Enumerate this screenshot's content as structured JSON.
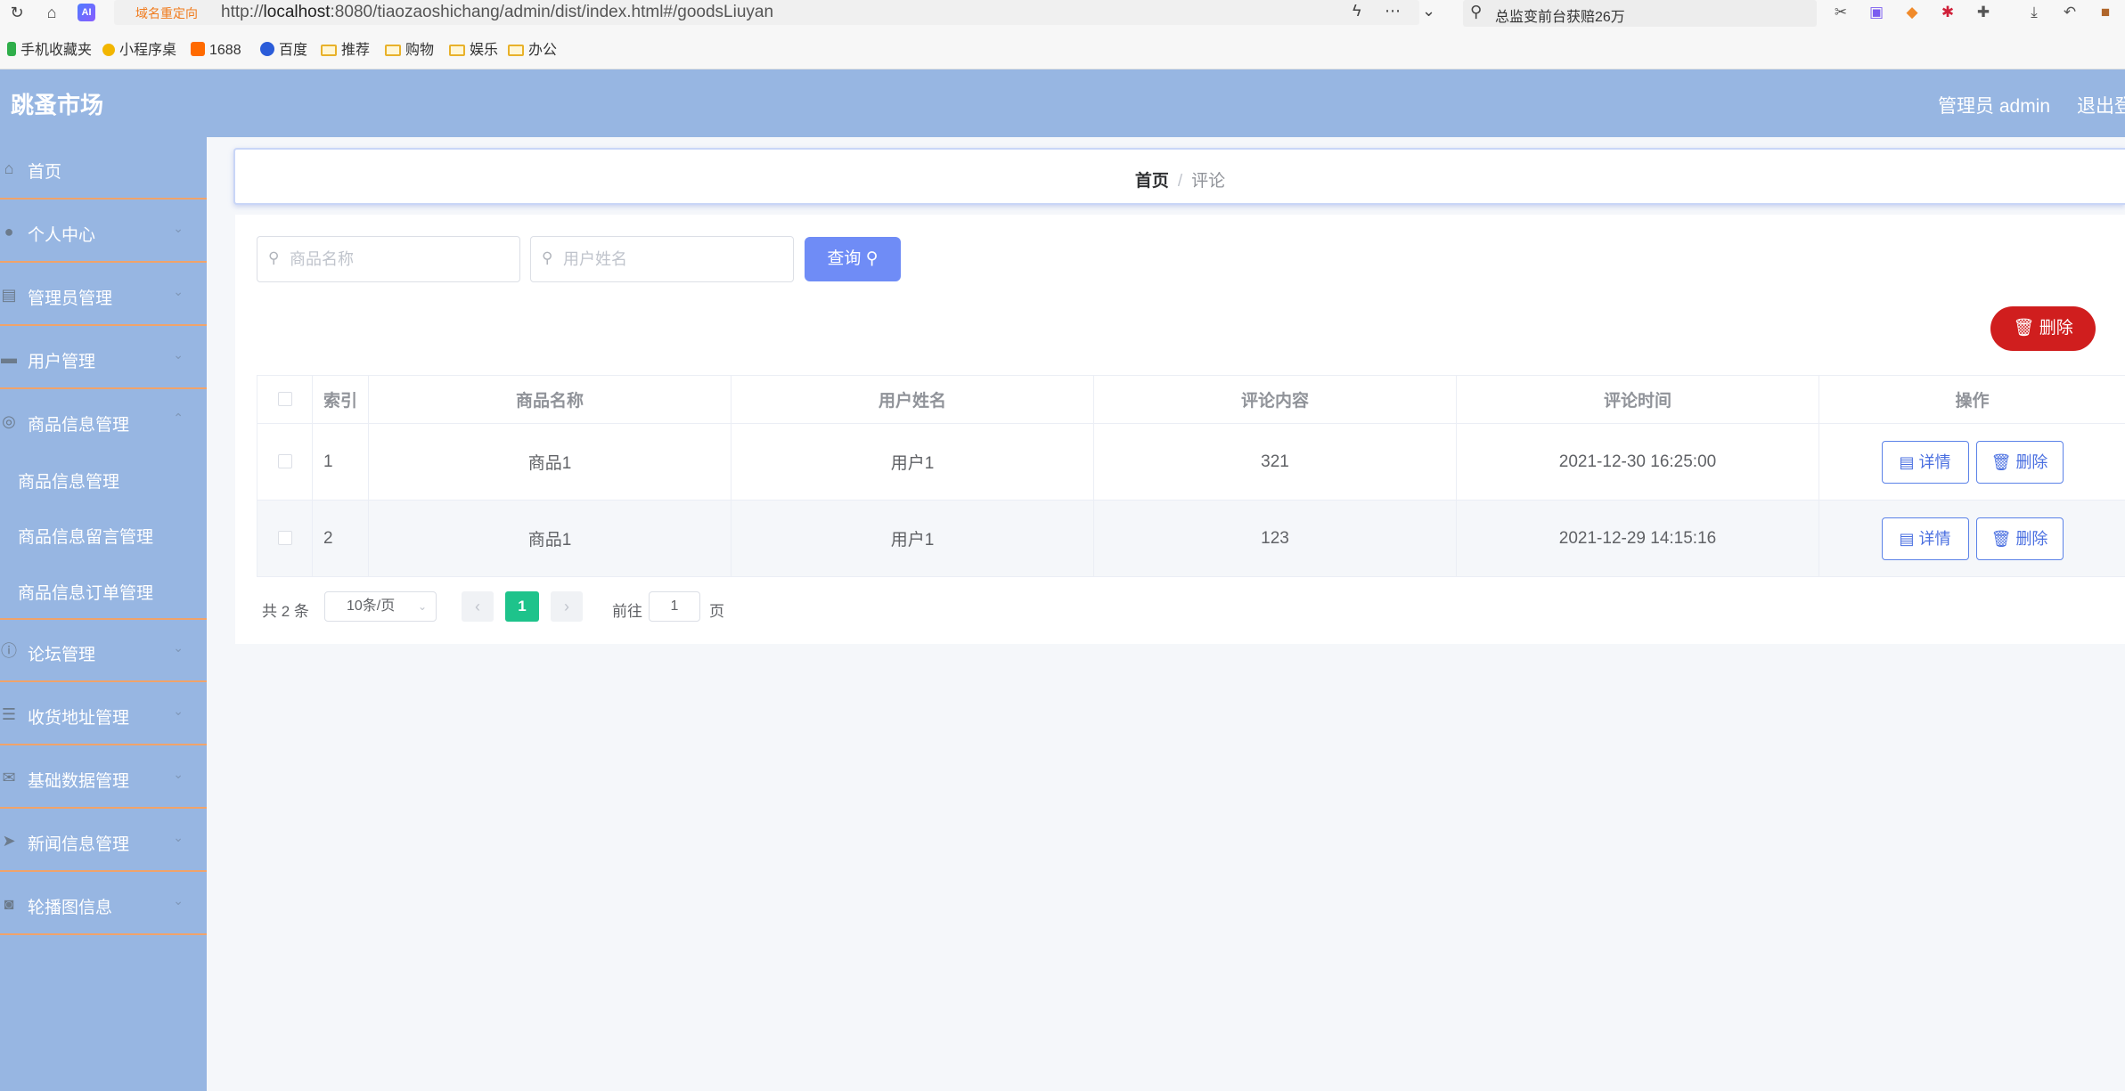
{
  "browser": {
    "redirect_tag": "域名重定向",
    "url_prefix": "http://",
    "url_host": "localhost",
    "url_rest": ":8080/tiaozaoshichang/admin/dist/index.html#/goodsLiuyan",
    "search_text": "总监变前台获赔26万",
    "ai_badge": "AI",
    "bookmarks": [
      {
        "label": "手机收藏夹",
        "color": "#2fae4a"
      },
      {
        "label": "小程序桌",
        "color": "#f2b600"
      },
      {
        "label": "1688",
        "color": "#ff6a00"
      },
      {
        "label": "百度",
        "color": "#2b5cd9"
      },
      {
        "label": "推荐",
        "color": "#e8b12a"
      },
      {
        "label": "购物",
        "color": "#e8b12a"
      },
      {
        "label": "娱乐",
        "color": "#e8b12a"
      },
      {
        "label": "办公",
        "color": "#e8b12a"
      }
    ]
  },
  "header": {
    "title": "跳蚤市场",
    "admin_label": "管理员 admin",
    "logout_label": "退出登"
  },
  "sidebar": {
    "items": [
      {
        "label": "首页",
        "icon": "home-icon"
      },
      {
        "label": "个人中心",
        "icon": "user-icon"
      },
      {
        "label": "管理员管理",
        "icon": "clipboard-icon"
      },
      {
        "label": "用户管理",
        "icon": "briefcase-icon"
      },
      {
        "label": "商品信息管理",
        "icon": "globe-icon"
      },
      {
        "label": "论坛管理",
        "icon": "info-icon"
      },
      {
        "label": "收货地址管理",
        "icon": "list-icon"
      },
      {
        "label": "基础数据管理",
        "icon": "mail-icon"
      },
      {
        "label": "新闻信息管理",
        "icon": "send-icon"
      },
      {
        "label": "轮播图信息",
        "icon": "camera-icon"
      }
    ],
    "submenu": [
      "商品信息管理",
      "商品信息留言管理",
      "商品信息订单管理"
    ]
  },
  "breadcrumb": {
    "home": "首页",
    "separator": "/",
    "current": "评论"
  },
  "search": {
    "goods_placeholder": "商品名称",
    "user_placeholder": "用户姓名",
    "query_label": "查询"
  },
  "toolbar": {
    "delete_label": "删除"
  },
  "table": {
    "headers": [
      "索引",
      "商品名称",
      "用户姓名",
      "评论内容",
      "评论时间",
      "操作"
    ],
    "rows": [
      {
        "index": "1",
        "goods": "商品1",
        "user": "用户1",
        "content": "321",
        "time": "2021-12-30 16:25:00"
      },
      {
        "index": "2",
        "goods": "商品1",
        "user": "用户1",
        "content": "123",
        "time": "2021-12-29 14:15:16"
      }
    ],
    "detail_label": "详情",
    "delete_label": "删除"
  },
  "pagination": {
    "total": "共 2 条",
    "page_size": "10条/页",
    "current_page": "1",
    "goto_label": "前往",
    "goto_value": "1",
    "page_suffix": "页"
  },
  "colors": {
    "sidebar_bg": "#97b6e2",
    "primary": "#6f8cf6",
    "danger": "#d01e1e",
    "pager_active": "#1ec38b"
  }
}
